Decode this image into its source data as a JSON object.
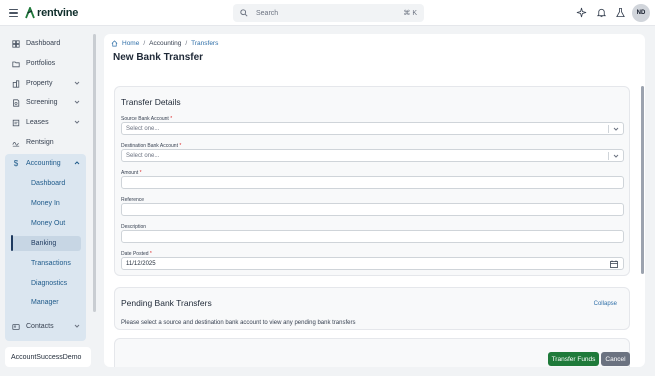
{
  "app": {
    "logo_text": "rentvine",
    "brand_color": "#0f2e2b"
  },
  "search": {
    "placeholder": "Search",
    "shortcut": "⌘ K"
  },
  "user": {
    "initials": "ND"
  },
  "sidebar": {
    "items": [
      {
        "label": "Dashboard",
        "icon": "dashboard-icon"
      },
      {
        "label": "Portfolios",
        "icon": "folder-icon"
      },
      {
        "label": "Property",
        "icon": "building-icon",
        "expandable": true
      },
      {
        "label": "Screening",
        "icon": "document-search-icon",
        "expandable": true
      },
      {
        "label": "Leases",
        "icon": "lease-icon",
        "expandable": true
      },
      {
        "label": "Rentsign",
        "icon": "signature-icon"
      }
    ],
    "accounting": {
      "label": "Accounting",
      "expanded": true,
      "sub_items": [
        {
          "label": "Dashboard"
        },
        {
          "label": "Money In"
        },
        {
          "label": "Money Out"
        },
        {
          "label": "Banking",
          "active": true
        },
        {
          "label": "Transactions"
        },
        {
          "label": "Diagnostics"
        },
        {
          "label": "Manager"
        }
      ]
    },
    "contacts": {
      "label": "Contacts",
      "icon": "contacts-icon"
    },
    "tenant_name": "AccountSuccessDemo"
  },
  "breadcrumb": {
    "home": "Home",
    "middle": "Accounting",
    "current": "Transfers"
  },
  "page": {
    "title": "New Bank Transfer"
  },
  "transfer_details": {
    "title": "Transfer Details",
    "fields": {
      "source": {
        "label": "Source Bank Account",
        "required_mark": "*",
        "placeholder": "Select one..."
      },
      "destination": {
        "label": "Destination Bank Account",
        "required_mark": "*",
        "placeholder": "Select one..."
      },
      "amount": {
        "label": "Amount",
        "required_mark": "*",
        "value": ""
      },
      "reference": {
        "label": "Reference",
        "value": ""
      },
      "description": {
        "label": "Description",
        "value": ""
      },
      "date_posted": {
        "label": "Date Posted",
        "required_mark": "*",
        "value": "11/12/2025"
      }
    }
  },
  "pending": {
    "title": "Pending Bank Transfers",
    "collapse_label": "Collapse",
    "message": "Please select a source and destination bank account to view any pending bank transfers"
  },
  "actions": {
    "submit_label": "Transfer Funds",
    "cancel_label": "Cancel"
  },
  "colors": {
    "primary": "#1f7a3a",
    "link": "#2f6fa8",
    "accent_bg": "#dbe6f0",
    "required": "#dc2626"
  }
}
